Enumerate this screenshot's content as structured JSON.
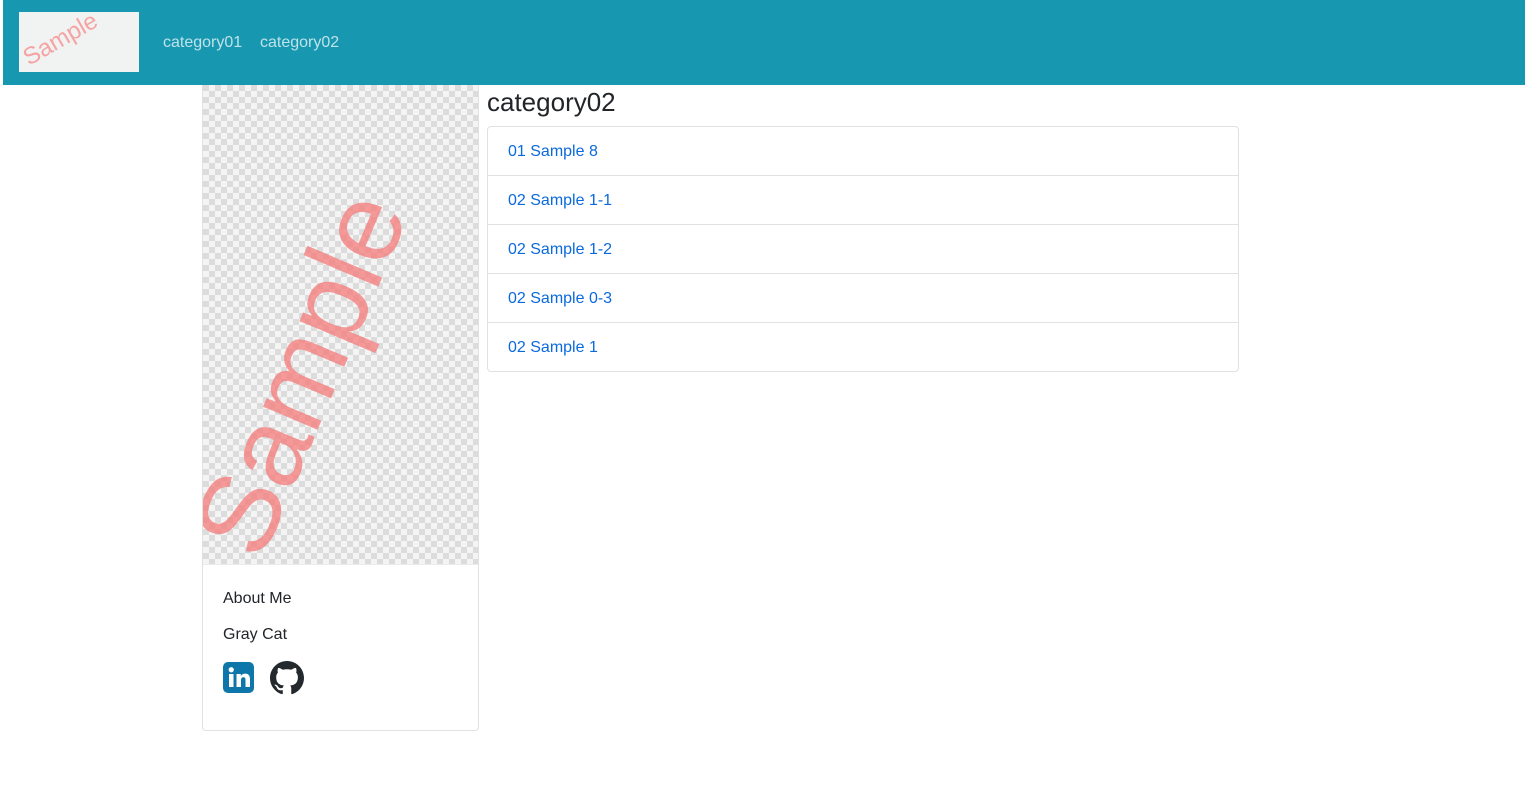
{
  "header": {
    "logo_text": "Sample",
    "nav": [
      {
        "label": "category01"
      },
      {
        "label": "category02"
      }
    ],
    "colors": {
      "background": "#1798b0",
      "link": "#d1ecf1"
    }
  },
  "sidebar": {
    "image_watermark": "Sample",
    "about_heading": "About Me",
    "author_name": "Gray Cat",
    "social": [
      {
        "icon": "linkedin-icon",
        "color": "#0e76a8"
      },
      {
        "icon": "github-icon",
        "color": "#24292e"
      }
    ]
  },
  "main": {
    "category_title": "category02",
    "posts": [
      {
        "title": "01 Sample 8"
      },
      {
        "title": "02 Sample 1-1"
      },
      {
        "title": "02 Sample 1-2"
      },
      {
        "title": "02 Sample 0-3"
      },
      {
        "title": "02 Sample 1"
      }
    ],
    "link_color": "#0a69dc"
  }
}
